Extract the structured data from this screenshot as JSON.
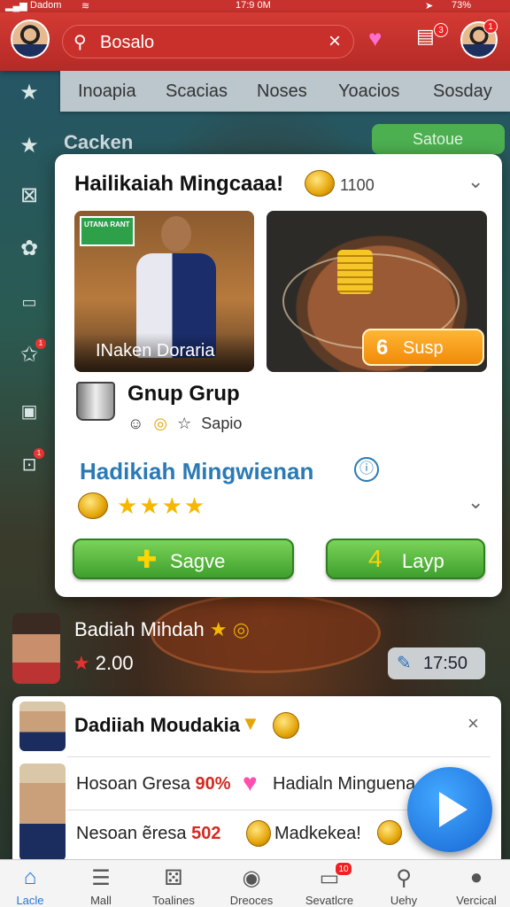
{
  "status_bar": {
    "carrier": "Dadom",
    "time": "17:9 0M",
    "battery": "73%"
  },
  "header": {
    "search_value": "Bosalo",
    "notification_count": "3",
    "profile_badge": "1"
  },
  "tabs": [
    "Inoapia",
    "Scacias",
    "Noses",
    "Yoacios",
    "Sosday"
  ],
  "sidebar": {
    "badges": [
      "1",
      "1"
    ]
  },
  "background": {
    "section_title": "Cacken",
    "button_label": "Satoue"
  },
  "card": {
    "title": "Hailikaiah Mingcaaa!",
    "coin_count": "1100",
    "tile1_sign": "UTANA RANT",
    "tile1_caption": "INaken Doraria",
    "tile2_button_number": "6",
    "tile2_button_label": "Susp",
    "group_title": "Gnup Grup",
    "group_meta": "Sapio",
    "subtitle": "Hadikiah Mingwienan",
    "star_count": 4,
    "buttons": {
      "left": "Sagve",
      "right": "Layp"
    }
  },
  "mid_row": {
    "title": "Badiah Mihdah",
    "value": "2.00",
    "timer": "17:50"
  },
  "bottom_card": {
    "title": "Dadiiah Moudakia",
    "rows": [
      {
        "left_text": "Hosoan Gresa",
        "left_pct": "90%",
        "right_text": "Hadialn Minguena"
      },
      {
        "left_text": "Nesoan ẽresa",
        "left_pct": "502",
        "right_text": "Madkekea!"
      }
    ]
  },
  "bottom_nav": [
    {
      "label": "Lacle",
      "icon": "home-icon",
      "active": true
    },
    {
      "label": "Mall",
      "icon": "list-icon",
      "active": false
    },
    {
      "label": "Toalines",
      "icon": "grid-icon",
      "active": false
    },
    {
      "label": "Dreoces",
      "icon": "circle-icon",
      "active": false
    },
    {
      "label": "Sevatlcre",
      "icon": "tv-icon",
      "active": false,
      "badge": "10"
    },
    {
      "label": "Uehy",
      "icon": "search-icon",
      "active": false
    },
    {
      "label": "Vercical",
      "icon": "person-icon",
      "active": false
    }
  ],
  "colors": {
    "brand_red": "#c7322e",
    "accent_blue": "#2a7ab5",
    "green": "#3ea02c",
    "orange": "#f18a09"
  }
}
